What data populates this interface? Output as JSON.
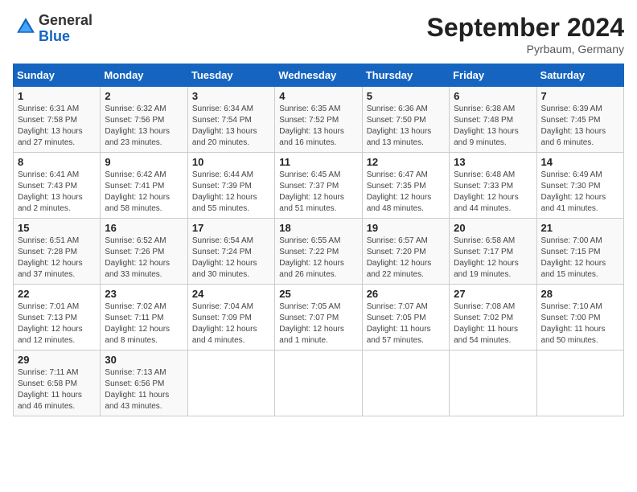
{
  "header": {
    "logo_line1": "General",
    "logo_line2": "Blue",
    "month": "September 2024",
    "location": "Pyrbaum, Germany"
  },
  "weekdays": [
    "Sunday",
    "Monday",
    "Tuesday",
    "Wednesday",
    "Thursday",
    "Friday",
    "Saturday"
  ],
  "weeks": [
    [
      {
        "day": "1",
        "sunrise": "6:31 AM",
        "sunset": "7:58 PM",
        "daylight": "13 hours and 27 minutes."
      },
      {
        "day": "2",
        "sunrise": "6:32 AM",
        "sunset": "7:56 PM",
        "daylight": "13 hours and 23 minutes."
      },
      {
        "day": "3",
        "sunrise": "6:34 AM",
        "sunset": "7:54 PM",
        "daylight": "13 hours and 20 minutes."
      },
      {
        "day": "4",
        "sunrise": "6:35 AM",
        "sunset": "7:52 PM",
        "daylight": "13 hours and 16 minutes."
      },
      {
        "day": "5",
        "sunrise": "6:36 AM",
        "sunset": "7:50 PM",
        "daylight": "13 hours and 13 minutes."
      },
      {
        "day": "6",
        "sunrise": "6:38 AM",
        "sunset": "7:48 PM",
        "daylight": "13 hours and 9 minutes."
      },
      {
        "day": "7",
        "sunrise": "6:39 AM",
        "sunset": "7:45 PM",
        "daylight": "13 hours and 6 minutes."
      }
    ],
    [
      {
        "day": "8",
        "sunrise": "6:41 AM",
        "sunset": "7:43 PM",
        "daylight": "13 hours and 2 minutes."
      },
      {
        "day": "9",
        "sunrise": "6:42 AM",
        "sunset": "7:41 PM",
        "daylight": "12 hours and 58 minutes."
      },
      {
        "day": "10",
        "sunrise": "6:44 AM",
        "sunset": "7:39 PM",
        "daylight": "12 hours and 55 minutes."
      },
      {
        "day": "11",
        "sunrise": "6:45 AM",
        "sunset": "7:37 PM",
        "daylight": "12 hours and 51 minutes."
      },
      {
        "day": "12",
        "sunrise": "6:47 AM",
        "sunset": "7:35 PM",
        "daylight": "12 hours and 48 minutes."
      },
      {
        "day": "13",
        "sunrise": "6:48 AM",
        "sunset": "7:33 PM",
        "daylight": "12 hours and 44 minutes."
      },
      {
        "day": "14",
        "sunrise": "6:49 AM",
        "sunset": "7:30 PM",
        "daylight": "12 hours and 41 minutes."
      }
    ],
    [
      {
        "day": "15",
        "sunrise": "6:51 AM",
        "sunset": "7:28 PM",
        "daylight": "12 hours and 37 minutes."
      },
      {
        "day": "16",
        "sunrise": "6:52 AM",
        "sunset": "7:26 PM",
        "daylight": "12 hours and 33 minutes."
      },
      {
        "day": "17",
        "sunrise": "6:54 AM",
        "sunset": "7:24 PM",
        "daylight": "12 hours and 30 minutes."
      },
      {
        "day": "18",
        "sunrise": "6:55 AM",
        "sunset": "7:22 PM",
        "daylight": "12 hours and 26 minutes."
      },
      {
        "day": "19",
        "sunrise": "6:57 AM",
        "sunset": "7:20 PM",
        "daylight": "12 hours and 22 minutes."
      },
      {
        "day": "20",
        "sunrise": "6:58 AM",
        "sunset": "7:17 PM",
        "daylight": "12 hours and 19 minutes."
      },
      {
        "day": "21",
        "sunrise": "7:00 AM",
        "sunset": "7:15 PM",
        "daylight": "12 hours and 15 minutes."
      }
    ],
    [
      {
        "day": "22",
        "sunrise": "7:01 AM",
        "sunset": "7:13 PM",
        "daylight": "12 hours and 12 minutes."
      },
      {
        "day": "23",
        "sunrise": "7:02 AM",
        "sunset": "7:11 PM",
        "daylight": "12 hours and 8 minutes."
      },
      {
        "day": "24",
        "sunrise": "7:04 AM",
        "sunset": "7:09 PM",
        "daylight": "12 hours and 4 minutes."
      },
      {
        "day": "25",
        "sunrise": "7:05 AM",
        "sunset": "7:07 PM",
        "daylight": "12 hours and 1 minute."
      },
      {
        "day": "26",
        "sunrise": "7:07 AM",
        "sunset": "7:05 PM",
        "daylight": "11 hours and 57 minutes."
      },
      {
        "day": "27",
        "sunrise": "7:08 AM",
        "sunset": "7:02 PM",
        "daylight": "11 hours and 54 minutes."
      },
      {
        "day": "28",
        "sunrise": "7:10 AM",
        "sunset": "7:00 PM",
        "daylight": "11 hours and 50 minutes."
      }
    ],
    [
      {
        "day": "29",
        "sunrise": "7:11 AM",
        "sunset": "6:58 PM",
        "daylight": "11 hours and 46 minutes."
      },
      {
        "day": "30",
        "sunrise": "7:13 AM",
        "sunset": "6:56 PM",
        "daylight": "11 hours and 43 minutes."
      },
      null,
      null,
      null,
      null,
      null
    ]
  ]
}
